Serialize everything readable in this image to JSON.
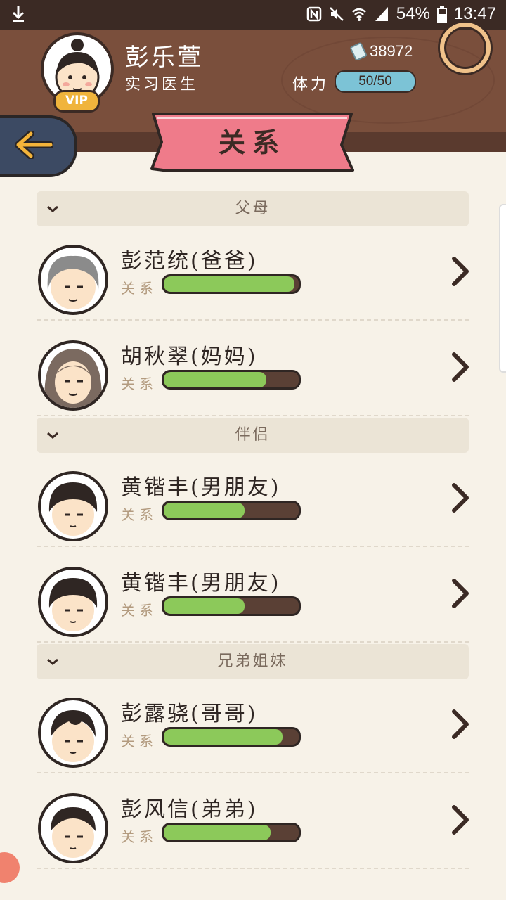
{
  "status_bar": {
    "battery": "54%",
    "time": "13:47"
  },
  "header": {
    "player_name": "彭乐萱",
    "player_title": "实习医生",
    "vip_label": "VIP",
    "money": "38972",
    "stamina_label": "体力",
    "stamina_value": "50/50"
  },
  "page": {
    "title": "关系"
  },
  "sections": [
    {
      "header": "父母",
      "items": [
        {
          "name": "彭范统(爸爸)",
          "label": "关系",
          "level": 0.97
        },
        {
          "name": "胡秋翠(妈妈)",
          "label": "关系",
          "level": 0.76
        }
      ]
    },
    {
      "header": "伴侣",
      "items": [
        {
          "name": "黄锴丰(男朋友)",
          "label": "关系",
          "level": 0.6
        },
        {
          "name": "黄锴丰(男朋友)",
          "label": "关系",
          "level": 0.6
        }
      ]
    },
    {
      "header": "兄弟姐妹",
      "items": [
        {
          "name": "彭露骁(哥哥)",
          "label": "关系",
          "level": 0.88
        },
        {
          "name": "彭风信(弟弟)",
          "label": "关系",
          "level": 0.79
        }
      ]
    }
  ],
  "colors": {
    "bar_fill": "#8cc95a",
    "bar_empty": "#5a4035",
    "ribbon": "#ef7b8a",
    "stamina": "#7cc3d6"
  }
}
